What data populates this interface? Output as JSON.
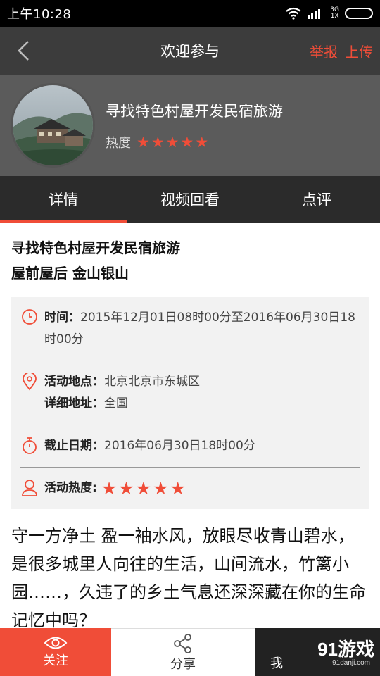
{
  "status_bar": {
    "time": "上午10:28",
    "network": "3G",
    "network_sub": "1X"
  },
  "nav": {
    "title": "欢迎参与",
    "report": "举报",
    "upload": "上传"
  },
  "header": {
    "event_title": "寻找特色村屋开发民宿旅游",
    "heat_label": "热度",
    "rating": 5
  },
  "tabs": [
    {
      "label": "详情",
      "active": true
    },
    {
      "label": "视频回看",
      "active": false
    },
    {
      "label": "点评",
      "active": false
    }
  ],
  "detail": {
    "title_line1": "寻找特色村屋开发民宿旅游",
    "title_line2": "屋前屋后 金山银山",
    "time_label": "时间：",
    "time_value": "2015年12月01日08时00分至2016年06月30日18时00分",
    "location_label": "活动地点：",
    "location_value": "北京北京市东城区",
    "address_label": "详细地址：",
    "address_value": "全国",
    "deadline_label": "截止日期：",
    "deadline_value": "2016年06月30日18时00分",
    "heat_label": "活动热度:",
    "heat_rating": 5,
    "description": "守一方净土 盈一袖水风，放眼尽收青山碧水，是很多城里人向往的生活，山间流水，竹篱小园……，久违了的乡土气息还深深藏在你的生命记忆中吗？"
  },
  "bottom_bar": {
    "follow": "关注",
    "share": "分享",
    "third": "我",
    "watermark": "91游戏",
    "watermark_url": "91danji.com"
  },
  "colors": {
    "accent": "#f04d38",
    "titlebar": "#3c3c3c",
    "header": "#5b5b5b",
    "tabs": "#2b2b2b"
  },
  "icons": [
    "back-icon",
    "wifi-icon",
    "signal-icon",
    "battery-icon",
    "star-icon",
    "clock-icon",
    "location-icon",
    "stopwatch-icon",
    "person-icon",
    "eye-icon",
    "share-icon"
  ]
}
